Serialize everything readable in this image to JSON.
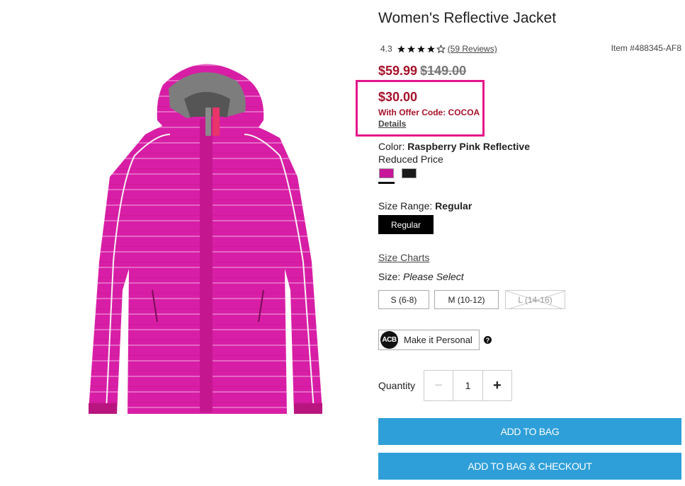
{
  "product": {
    "title": "Women's Reflective Jacket",
    "rating": "4.3",
    "stars": 4,
    "reviews_link": "(59 Reviews)",
    "item_number": "Item #488345-AF8",
    "image_icon": "jacket-image"
  },
  "pricing": {
    "sale_price": "$59.99",
    "original_price": "$149.00",
    "offer_price": "$30.00",
    "offer_code_text": "With Offer Code: COCOA",
    "details_link": "Details"
  },
  "color": {
    "label": "Color:",
    "selected": "Raspberry Pink Reflective",
    "note": "Reduced Price",
    "swatches": [
      {
        "name": "Raspberry Pink Reflective",
        "color": "#c8179a",
        "selected": true
      },
      {
        "name": "Black",
        "color": "#1a1a1a",
        "selected": false
      }
    ]
  },
  "size_range": {
    "label": "Size Range:",
    "selected": "Regular",
    "options": [
      "Regular"
    ]
  },
  "size": {
    "charts_link": "Size Charts",
    "label": "Size:",
    "placeholder": "Please Select",
    "options": [
      {
        "label": "S (6-8)",
        "available": true
      },
      {
        "label": "M (10-12)",
        "available": true
      },
      {
        "label": "L (14-16)",
        "available": false
      }
    ]
  },
  "personalize": {
    "icon_text": "ACB",
    "label": "Make it Personal",
    "help_icon": "?"
  },
  "quantity": {
    "label": "Quantity",
    "minus": "−",
    "value": "1",
    "plus": "+"
  },
  "actions": {
    "add_to_bag": "ADD TO BAG",
    "add_to_bag_checkout": "ADD TO BAG & CHECKOUT"
  },
  "colors": {
    "sale_red": "#a5122a",
    "highlight_pink": "#e5178a",
    "cta_blue": "#2e9fd8"
  }
}
